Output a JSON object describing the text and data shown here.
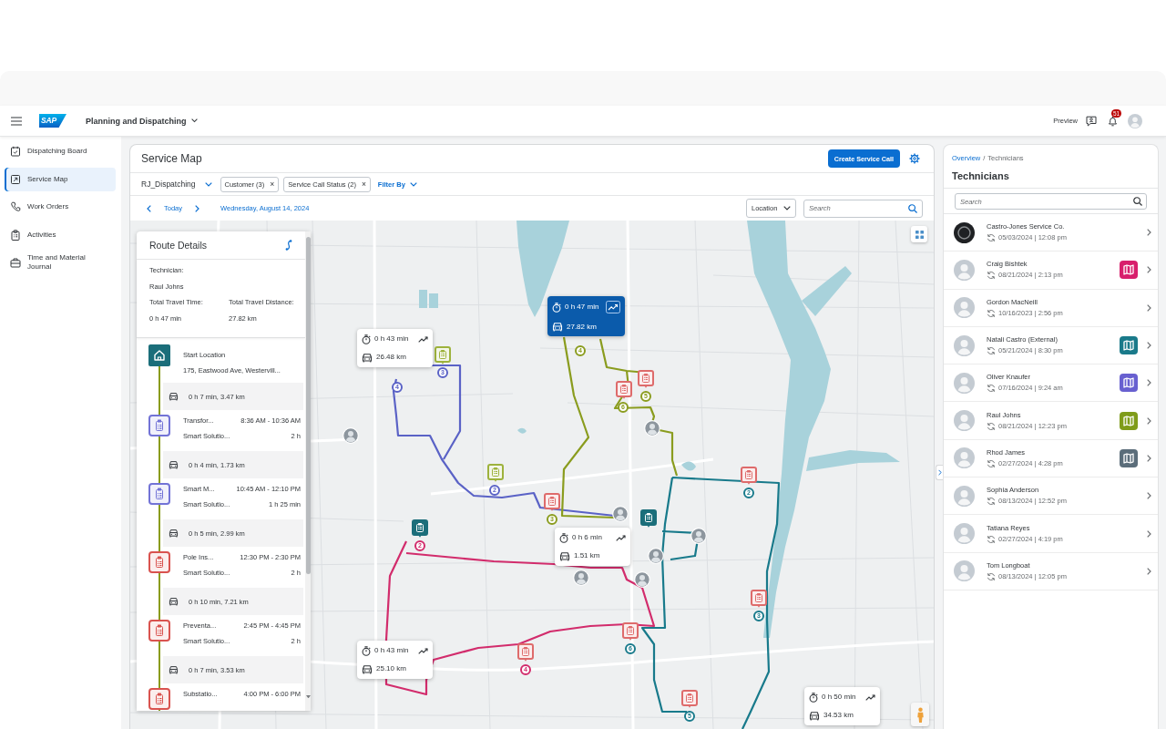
{
  "shell_bar": {
    "logo": "SAP",
    "app_title": "Planning and Dispatching",
    "preview_label": "Preview",
    "notifications": {
      "count": "51"
    }
  },
  "sidebar": {
    "items": [
      {
        "kind": "board",
        "label": "Dispatching Board",
        "selected": false
      },
      {
        "kind": "map",
        "label": "Service Map",
        "selected": true
      },
      {
        "kind": "orders",
        "label": "Work Orders",
        "selected": false
      },
      {
        "kind": "activities",
        "label": "Activities",
        "selected": false
      },
      {
        "kind": "journal",
        "label": "Time and Material Journal",
        "selected": false
      }
    ]
  },
  "service_map": {
    "title": "Service Map",
    "create_button": "Create Service Call",
    "variant": "RJ_Dispatching",
    "filters": [
      {
        "label": "Customer (3)",
        "remove": "×"
      },
      {
        "label": "Service Call Status (2)",
        "remove": "×"
      }
    ],
    "filter_by": "Filter By",
    "today": "Today",
    "date": "Wednesday, August 14, 2024",
    "view_select": "Location",
    "search": {
      "placeholder": "Search"
    },
    "map": {
      "routes": [
        {
          "color": "#5a62c6"
        },
        {
          "color": "#8a9c1e"
        },
        {
          "color": "#187a8b"
        },
        {
          "color": "#d22c6c"
        }
      ],
      "route_summaries": [
        {
          "time": "0 h 43 min",
          "distance": "26.48 km",
          "selected": false
        },
        {
          "time": "0 h 47 min",
          "distance": "27.82 km",
          "selected": true
        },
        {
          "time": "0 h 6 min",
          "distance": "1.51 km",
          "selected": false
        },
        {
          "time": "0 h 43 min",
          "distance": "25.10 km",
          "selected": false
        },
        {
          "time": "0 h 50 min",
          "distance": "34.53 km",
          "selected": false
        }
      ],
      "service_calls": [
        {
          "color": "#9db23c",
          "filled": false
        },
        {
          "color": "#de6b6b",
          "filled": false
        },
        {
          "color": "#de6b6b",
          "filled": false
        },
        {
          "color": "#9db23c",
          "filled": false
        },
        {
          "color": "#de6b6b",
          "filled": false
        },
        {
          "color": "#1b6e7a",
          "filled": true
        },
        {
          "color": "#1b6e7a",
          "filled": true
        },
        {
          "color": "#de6b6b",
          "filled": false
        },
        {
          "color": "#de6b6b",
          "filled": false
        },
        {
          "color": "#de6b6b",
          "filled": false
        },
        {
          "color": "#de6b6b",
          "filled": false
        },
        {
          "color": "#de6b6b",
          "filled": false
        }
      ],
      "stop_numbers": [
        {
          "number": "3",
          "color": "#5a62c6"
        },
        {
          "number": "4",
          "color": "#5a62c6"
        },
        {
          "number": "2",
          "color": "#5a62c6"
        },
        {
          "number": "3",
          "color": "#8a9c1e"
        },
        {
          "number": "4",
          "color": "#8a9c1e"
        },
        {
          "number": "5",
          "color": "#8a9c1e"
        },
        {
          "number": "6",
          "color": "#8a9c1e"
        },
        {
          "number": "2",
          "color": "#187a8b"
        },
        {
          "number": "3",
          "color": "#187a8b"
        },
        {
          "number": "6",
          "color": "#187a8b"
        },
        {
          "number": "4",
          "color": "#d22c6c"
        },
        {
          "number": "2",
          "color": "#d22c6c"
        },
        {
          "number": "5",
          "color": "#187a8b"
        }
      ]
    },
    "route_details": {
      "title": "Route Details",
      "technician_label": "Technician:",
      "technician": "Raul Johns",
      "time_label": "Total Travel Time:",
      "distance_label": "Total Travel Distance:",
      "time": "0 h 47 min",
      "distance": "27.82 km",
      "timeline": [
        {
          "kind": "start",
          "title": "Start Location",
          "address": "175, Eastwood Ave, Westervill..."
        },
        {
          "kind": "travel",
          "text": "0 h 7 min, 3.47 km"
        },
        {
          "kind": "stop",
          "color": "#7273d6",
          "title": "Transfor...",
          "time": "8:36 AM - 10:36 AM",
          "customer": "Smart Solutio...",
          "duration": "2 h"
        },
        {
          "kind": "travel",
          "text": "0 h 4 min, 1.73 km"
        },
        {
          "kind": "stop",
          "color": "#7273d6",
          "title": "Smart M...",
          "time": "10:45 AM - 12:10 PM",
          "customer": "Smart Solutio...",
          "duration": "1 h 25 min"
        },
        {
          "kind": "travel",
          "text": "0 h 5 min, 2.99 km"
        },
        {
          "kind": "stop",
          "color": "#d9534f",
          "title": "Pole Ins...",
          "time": "12:30 PM - 2:30 PM",
          "customer": "Smart Solutio...",
          "duration": "2 h"
        },
        {
          "kind": "travel",
          "text": "0 h 10 min, 7.21 km"
        },
        {
          "kind": "stop",
          "color": "#d9534f",
          "title": "Preventa...",
          "time": "2:45 PM - 4:45 PM",
          "customer": "Smart Solutio...",
          "duration": "2 h"
        },
        {
          "kind": "travel",
          "text": "0 h 7 min, 3.53 km"
        },
        {
          "kind": "stop",
          "color": "#d9534f",
          "title": "Substatio...",
          "time": "4:00 PM - 6:00 PM"
        }
      ]
    }
  },
  "technicians": {
    "breadcrumb": [
      {
        "label": "Overview",
        "link": true
      },
      {
        "label": "Technicians",
        "link": false
      }
    ],
    "breadcrumb_separator": "/",
    "title": "Technicians",
    "search": {
      "placeholder": "Search"
    },
    "items": [
      {
        "kind": "company",
        "name": "Castro-Jones Service Co.",
        "synced": "05/03/2024 | 12:08 pm"
      },
      {
        "kind": "person",
        "name": "Craig Bishtek",
        "synced": "08/21/2024 | 2:13 pm",
        "color": "#d81f6c"
      },
      {
        "kind": "person",
        "name": "Gordon MacNeill",
        "synced": "10/16/2023 | 2:56 pm"
      },
      {
        "kind": "person",
        "name": "Natali Castro (External)",
        "synced": "05/21/2024 | 8:30 pm",
        "color": "#1a7a8a"
      },
      {
        "kind": "person",
        "name": "Oliver Knaufer",
        "synced": "07/16/2024 | 9:24 am",
        "color": "#6860d0"
      },
      {
        "kind": "person",
        "name": "Raul Johns",
        "synced": "08/21/2024 | 12:23 pm",
        "color": "#7f9c1a"
      },
      {
        "kind": "person",
        "name": "Rhod James",
        "synced": "02/27/2024 | 4:28 pm",
        "color": "#5b6d7a"
      },
      {
        "kind": "person",
        "name": "Sophia Anderson",
        "synced": "08/13/2024 | 12:52 pm"
      },
      {
        "kind": "person",
        "name": "Tatiana Reyes",
        "synced": "02/27/2024 | 4:19 pm"
      },
      {
        "kind": "person",
        "name": "Tom Longboat",
        "synced": "08/13/2024 | 12:05 pm"
      }
    ]
  }
}
